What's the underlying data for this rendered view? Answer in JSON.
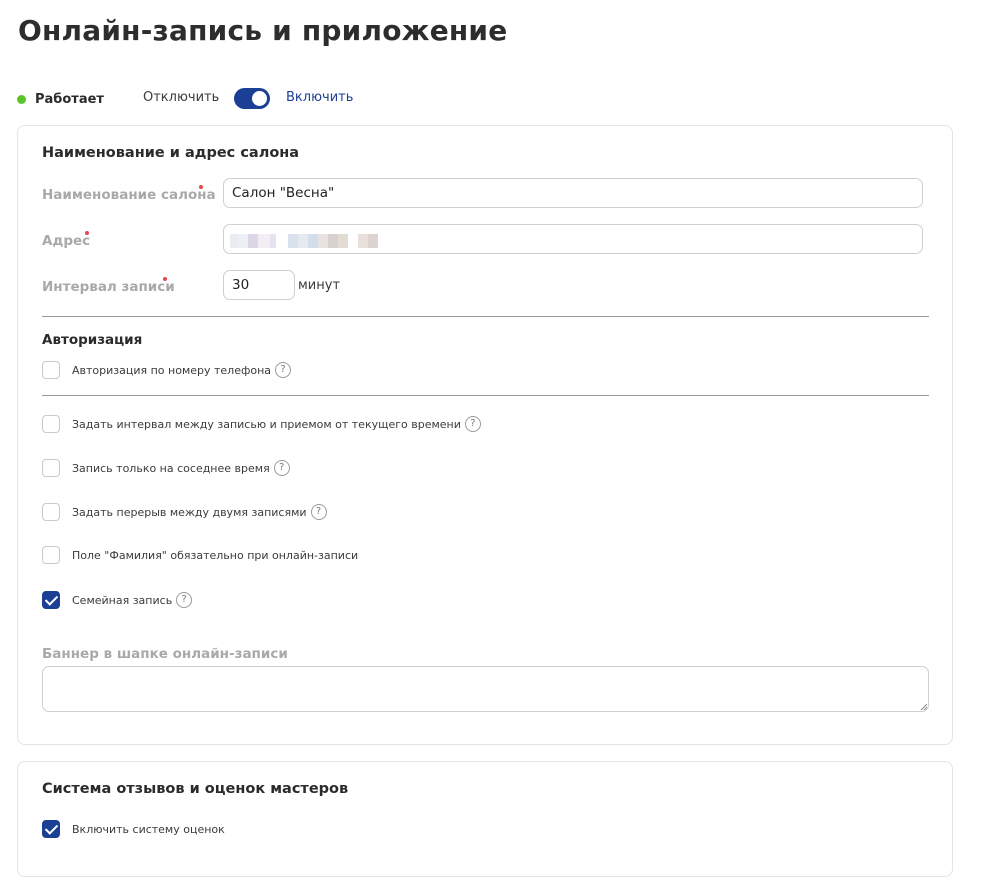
{
  "page": {
    "title": "Онлайн-запись и приложение"
  },
  "status": {
    "text": "Работает",
    "off_label": "Отключить",
    "on_label": "Включить",
    "enabled": true,
    "dot_color": "#5bc42a",
    "accent_color": "#1b3f95"
  },
  "salon": {
    "section_title": "Наименование и адрес салона",
    "name_label": "Наименование салона",
    "name_value": "Салон \"Весна\"",
    "address_label": "Адрес",
    "address_value": "",
    "interval_label": "Интервал записи",
    "interval_value": "30",
    "interval_unit": "минут"
  },
  "auth": {
    "section_title": "Авторизация",
    "phone_auth_label": "Авторизация по номеру телефона",
    "phone_auth_checked": false
  },
  "options": [
    {
      "label": "Задать интервал между записью и приемом от текущего времени",
      "checked": false,
      "help": true
    },
    {
      "label": "Запись только на соседнее время",
      "checked": false,
      "help": true
    },
    {
      "label": "Задать перерыв между двумя записями",
      "checked": false,
      "help": true
    },
    {
      "label": "Поле \"Фамилия\" обязательно при онлайн-записи",
      "checked": false,
      "help": false
    },
    {
      "label": "Семейная запись",
      "checked": true,
      "help": true
    }
  ],
  "banner": {
    "label": "Баннер в шапке онлайн-записи",
    "value": ""
  },
  "reviews": {
    "section_title": "Система отзывов и оценок мастеров",
    "enable_label": "Включить систему оценок",
    "enable_checked": true
  },
  "icons": {
    "help": "question-mark-icon",
    "check": "checkmark-icon"
  },
  "help_glyph": "?"
}
